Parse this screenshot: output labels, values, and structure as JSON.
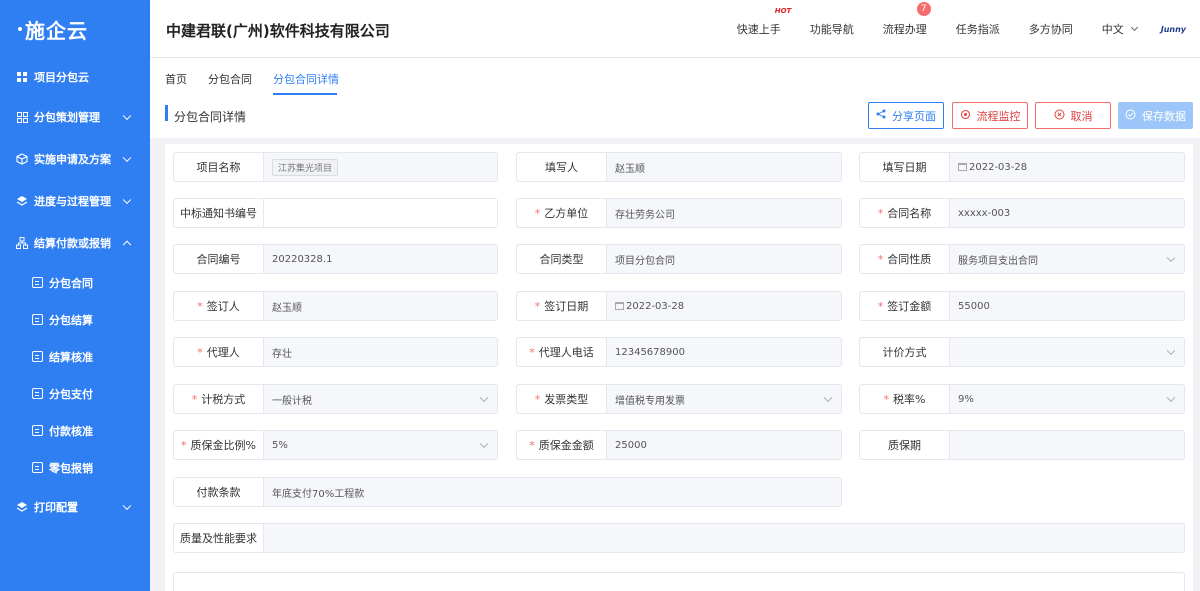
{
  "app": {
    "logo": "施企云",
    "company": "中建君联(广州)软件科技有限公司"
  },
  "header": {
    "nav": [
      {
        "label": "快速上手",
        "badge": "HOT"
      },
      {
        "label": "功能导航"
      },
      {
        "label": "流程办理",
        "count": "7"
      },
      {
        "label": "任务指派"
      },
      {
        "label": "多方协同"
      }
    ],
    "language": "中文",
    "brand": "Junny"
  },
  "sidebar": {
    "items": [
      {
        "label": "项目分包云",
        "icon": "grid-icon"
      },
      {
        "label": "分包策划管理",
        "icon": "apps-icon"
      },
      {
        "label": "实施申请及方案",
        "icon": "cube-icon"
      },
      {
        "label": "进度与过程管理",
        "icon": "layers-icon"
      },
      {
        "label": "结算付款或报销",
        "icon": "org-icon",
        "expanded": true
      },
      {
        "label": "打印配置",
        "icon": "layers-icon"
      }
    ],
    "sub_items": [
      "分包合同",
      "分包结算",
      "结算核准",
      "分包支付",
      "付款核准",
      "零包报销"
    ]
  },
  "breadcrumb": {
    "tabs": [
      "首页",
      "分包合同",
      "分包合同详情"
    ],
    "active": "分包合同详情"
  },
  "title": "分包合同详情",
  "toolbar": {
    "share": "分享页面",
    "flow": "流程监控",
    "cancel": "取消",
    "save": "保存数据"
  },
  "form": {
    "project_name": {
      "label": "项目名称",
      "value": "江苏集光项目"
    },
    "filler": {
      "label": "填写人",
      "value": "赵玉顺"
    },
    "fill_date": {
      "label": "填写日期",
      "value": "2022-03-28"
    },
    "bid_notice_no": {
      "label": "中标通知书编号",
      "value": ""
    },
    "party_b": {
      "label": "乙方单位",
      "value": "存壮劳务公司",
      "required": true
    },
    "contract_name": {
      "label": "合同名称",
      "value": "xxxxx-003",
      "required": true
    },
    "contract_no": {
      "label": "合同编号",
      "value": "20220328.1"
    },
    "contract_type": {
      "label": "合同类型",
      "value": "项目分包合同"
    },
    "contract_nature": {
      "label": "合同性质",
      "value": "服务项目支出合同",
      "required": true
    },
    "signer": {
      "label": "签订人",
      "value": "赵玉顺",
      "required": true
    },
    "sign_date": {
      "label": "签订日期",
      "value": "2022-03-28",
      "required": true
    },
    "sign_amount": {
      "label": "签订金额",
      "value": "55000",
      "required": true
    },
    "agent": {
      "label": "代理人",
      "value": "存壮",
      "required": true
    },
    "agent_phone": {
      "label": "代理人电话",
      "value": "12345678900",
      "required": true
    },
    "pricing_method": {
      "label": "计价方式",
      "value": ""
    },
    "tax_method": {
      "label": "计税方式",
      "value": "一般计税",
      "required": true
    },
    "invoice_type": {
      "label": "发票类型",
      "value": "增值税专用发票",
      "required": true
    },
    "tax_rate": {
      "label": "税率%",
      "value": "9%",
      "required": true
    },
    "retention_ratio": {
      "label": "质保金比例%",
      "value": "5%",
      "required": true
    },
    "retention_amount": {
      "label": "质保金金额",
      "value": "25000",
      "required": true
    },
    "warranty_period": {
      "label": "质保期",
      "value": ""
    },
    "payment_terms": {
      "label": "付款条款",
      "value": "年底支付70%工程款"
    },
    "quality_req": {
      "label": "质量及性能要求",
      "value": ""
    }
  },
  "colors": {
    "sidebar": "#2f7ff2",
    "accent": "#2f7ff2",
    "danger": "#f56c6c",
    "save_disabled": "#9cc6fa"
  }
}
